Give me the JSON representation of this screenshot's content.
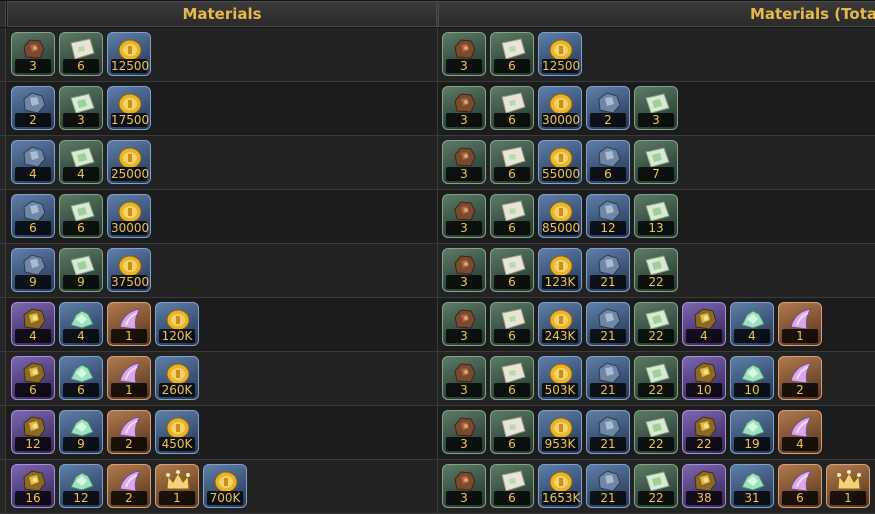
{
  "headers": {
    "materials": "Materials",
    "materials_total": "Materials (Tota"
  },
  "icon_colors": {
    "green": "#3a5246",
    "blue": "#3d5478",
    "purple": "#52407c",
    "orange": "#7c5232",
    "count_text": "#f0c24e",
    "header_text": "#e8b84a"
  },
  "rows": [
    {
      "materials": [
        {
          "icon": "brown-ore-icon",
          "quality": "green",
          "count": "3"
        },
        {
          "icon": "paper-scroll-icon",
          "quality": "green",
          "count": "6"
        },
        {
          "icon": "gold-coin-icon",
          "quality": "blue",
          "count": "12500"
        }
      ],
      "total": [
        {
          "icon": "brown-ore-icon",
          "quality": "green",
          "count": "3"
        },
        {
          "icon": "paper-scroll-icon",
          "quality": "green",
          "count": "6"
        },
        {
          "icon": "gold-coin-icon",
          "quality": "blue",
          "count": "12500"
        }
      ]
    },
    {
      "materials": [
        {
          "icon": "silver-ore-icon",
          "quality": "blue",
          "count": "2"
        },
        {
          "icon": "green-paper-icon",
          "quality": "green",
          "count": "3"
        },
        {
          "icon": "gold-coin-icon",
          "quality": "blue",
          "count": "17500"
        }
      ],
      "total": [
        {
          "icon": "brown-ore-icon",
          "quality": "green",
          "count": "3"
        },
        {
          "icon": "paper-scroll-icon",
          "quality": "green",
          "count": "6"
        },
        {
          "icon": "gold-coin-icon",
          "quality": "blue",
          "count": "30000"
        },
        {
          "icon": "silver-ore-icon",
          "quality": "blue",
          "count": "2"
        },
        {
          "icon": "green-paper-icon",
          "quality": "green",
          "count": "3"
        }
      ]
    },
    {
      "materials": [
        {
          "icon": "silver-ore-icon",
          "quality": "blue",
          "count": "4"
        },
        {
          "icon": "green-paper-icon",
          "quality": "green",
          "count": "4"
        },
        {
          "icon": "gold-coin-icon",
          "quality": "blue",
          "count": "25000"
        }
      ],
      "total": [
        {
          "icon": "brown-ore-icon",
          "quality": "green",
          "count": "3"
        },
        {
          "icon": "paper-scroll-icon",
          "quality": "green",
          "count": "6"
        },
        {
          "icon": "gold-coin-icon",
          "quality": "blue",
          "count": "55000"
        },
        {
          "icon": "silver-ore-icon",
          "quality": "blue",
          "count": "6"
        },
        {
          "icon": "green-paper-icon",
          "quality": "green",
          "count": "7"
        }
      ]
    },
    {
      "materials": [
        {
          "icon": "silver-ore-icon",
          "quality": "blue",
          "count": "6"
        },
        {
          "icon": "green-paper-icon",
          "quality": "green",
          "count": "6"
        },
        {
          "icon": "gold-coin-icon",
          "quality": "blue",
          "count": "30000"
        }
      ],
      "total": [
        {
          "icon": "brown-ore-icon",
          "quality": "green",
          "count": "3"
        },
        {
          "icon": "paper-scroll-icon",
          "quality": "green",
          "count": "6"
        },
        {
          "icon": "gold-coin-icon",
          "quality": "blue",
          "count": "85000"
        },
        {
          "icon": "silver-ore-icon",
          "quality": "blue",
          "count": "12"
        },
        {
          "icon": "green-paper-icon",
          "quality": "green",
          "count": "13"
        }
      ]
    },
    {
      "materials": [
        {
          "icon": "silver-ore-icon",
          "quality": "blue",
          "count": "9"
        },
        {
          "icon": "green-paper-icon",
          "quality": "green",
          "count": "9"
        },
        {
          "icon": "gold-coin-icon",
          "quality": "blue",
          "count": "37500"
        }
      ],
      "total": [
        {
          "icon": "brown-ore-icon",
          "quality": "green",
          "count": "3"
        },
        {
          "icon": "paper-scroll-icon",
          "quality": "green",
          "count": "6"
        },
        {
          "icon": "gold-coin-icon",
          "quality": "blue",
          "count": "123K"
        },
        {
          "icon": "silver-ore-icon",
          "quality": "blue",
          "count": "21"
        },
        {
          "icon": "green-paper-icon",
          "quality": "green",
          "count": "22"
        }
      ]
    },
    {
      "materials": [
        {
          "icon": "gold-ore-icon",
          "quality": "purple",
          "count": "4"
        },
        {
          "icon": "green-crystal-icon",
          "quality": "blue",
          "count": "4"
        },
        {
          "icon": "pink-horn-icon",
          "quality": "orange",
          "count": "1"
        },
        {
          "icon": "gold-coin-icon",
          "quality": "blue",
          "count": "120K"
        }
      ],
      "total": [
        {
          "icon": "brown-ore-icon",
          "quality": "green",
          "count": "3"
        },
        {
          "icon": "paper-scroll-icon",
          "quality": "green",
          "count": "6"
        },
        {
          "icon": "gold-coin-icon",
          "quality": "blue",
          "count": "243K"
        },
        {
          "icon": "silver-ore-icon",
          "quality": "blue",
          "count": "21"
        },
        {
          "icon": "green-paper-icon",
          "quality": "green",
          "count": "22"
        },
        {
          "icon": "gold-ore-icon",
          "quality": "purple",
          "count": "4"
        },
        {
          "icon": "green-crystal-icon",
          "quality": "blue",
          "count": "4"
        },
        {
          "icon": "pink-horn-icon",
          "quality": "orange",
          "count": "1"
        }
      ]
    },
    {
      "materials": [
        {
          "icon": "gold-ore-icon",
          "quality": "purple",
          "count": "6"
        },
        {
          "icon": "green-crystal-icon",
          "quality": "blue",
          "count": "6"
        },
        {
          "icon": "pink-horn-icon",
          "quality": "orange",
          "count": "1"
        },
        {
          "icon": "gold-coin-icon",
          "quality": "blue",
          "count": "260K"
        }
      ],
      "total": [
        {
          "icon": "brown-ore-icon",
          "quality": "green",
          "count": "3"
        },
        {
          "icon": "paper-scroll-icon",
          "quality": "green",
          "count": "6"
        },
        {
          "icon": "gold-coin-icon",
          "quality": "blue",
          "count": "503K"
        },
        {
          "icon": "silver-ore-icon",
          "quality": "blue",
          "count": "21"
        },
        {
          "icon": "green-paper-icon",
          "quality": "green",
          "count": "22"
        },
        {
          "icon": "gold-ore-icon",
          "quality": "purple",
          "count": "10"
        },
        {
          "icon": "green-crystal-icon",
          "quality": "blue",
          "count": "10"
        },
        {
          "icon": "pink-horn-icon",
          "quality": "orange",
          "count": "2"
        }
      ]
    },
    {
      "materials": [
        {
          "icon": "gold-ore-icon",
          "quality": "purple",
          "count": "12"
        },
        {
          "icon": "green-crystal-icon",
          "quality": "blue",
          "count": "9"
        },
        {
          "icon": "pink-horn-icon",
          "quality": "orange",
          "count": "2"
        },
        {
          "icon": "gold-coin-icon",
          "quality": "blue",
          "count": "450K"
        }
      ],
      "total": [
        {
          "icon": "brown-ore-icon",
          "quality": "green",
          "count": "3"
        },
        {
          "icon": "paper-scroll-icon",
          "quality": "green",
          "count": "6"
        },
        {
          "icon": "gold-coin-icon",
          "quality": "blue",
          "count": "953K"
        },
        {
          "icon": "silver-ore-icon",
          "quality": "blue",
          "count": "21"
        },
        {
          "icon": "green-paper-icon",
          "quality": "green",
          "count": "22"
        },
        {
          "icon": "gold-ore-icon",
          "quality": "purple",
          "count": "22"
        },
        {
          "icon": "green-crystal-icon",
          "quality": "blue",
          "count": "19"
        },
        {
          "icon": "pink-horn-icon",
          "quality": "orange",
          "count": "4"
        }
      ]
    },
    {
      "materials": [
        {
          "icon": "gold-ore-icon",
          "quality": "purple",
          "count": "16"
        },
        {
          "icon": "green-crystal-icon",
          "quality": "blue",
          "count": "12"
        },
        {
          "icon": "pink-horn-icon",
          "quality": "orange",
          "count": "2"
        },
        {
          "icon": "gold-crown-icon",
          "quality": "orange",
          "count": "1"
        },
        {
          "icon": "gold-coin-icon",
          "quality": "blue",
          "count": "700K"
        }
      ],
      "total": [
        {
          "icon": "brown-ore-icon",
          "quality": "green",
          "count": "3"
        },
        {
          "icon": "paper-scroll-icon",
          "quality": "green",
          "count": "6"
        },
        {
          "icon": "gold-coin-icon",
          "quality": "blue",
          "count": "1653K"
        },
        {
          "icon": "silver-ore-icon",
          "quality": "blue",
          "count": "21"
        },
        {
          "icon": "green-paper-icon",
          "quality": "green",
          "count": "22"
        },
        {
          "icon": "gold-ore-icon",
          "quality": "purple",
          "count": "38"
        },
        {
          "icon": "green-crystal-icon",
          "quality": "blue",
          "count": "31"
        },
        {
          "icon": "pink-horn-icon",
          "quality": "orange",
          "count": "6"
        },
        {
          "icon": "gold-crown-icon",
          "quality": "orange",
          "count": "1"
        }
      ]
    }
  ]
}
